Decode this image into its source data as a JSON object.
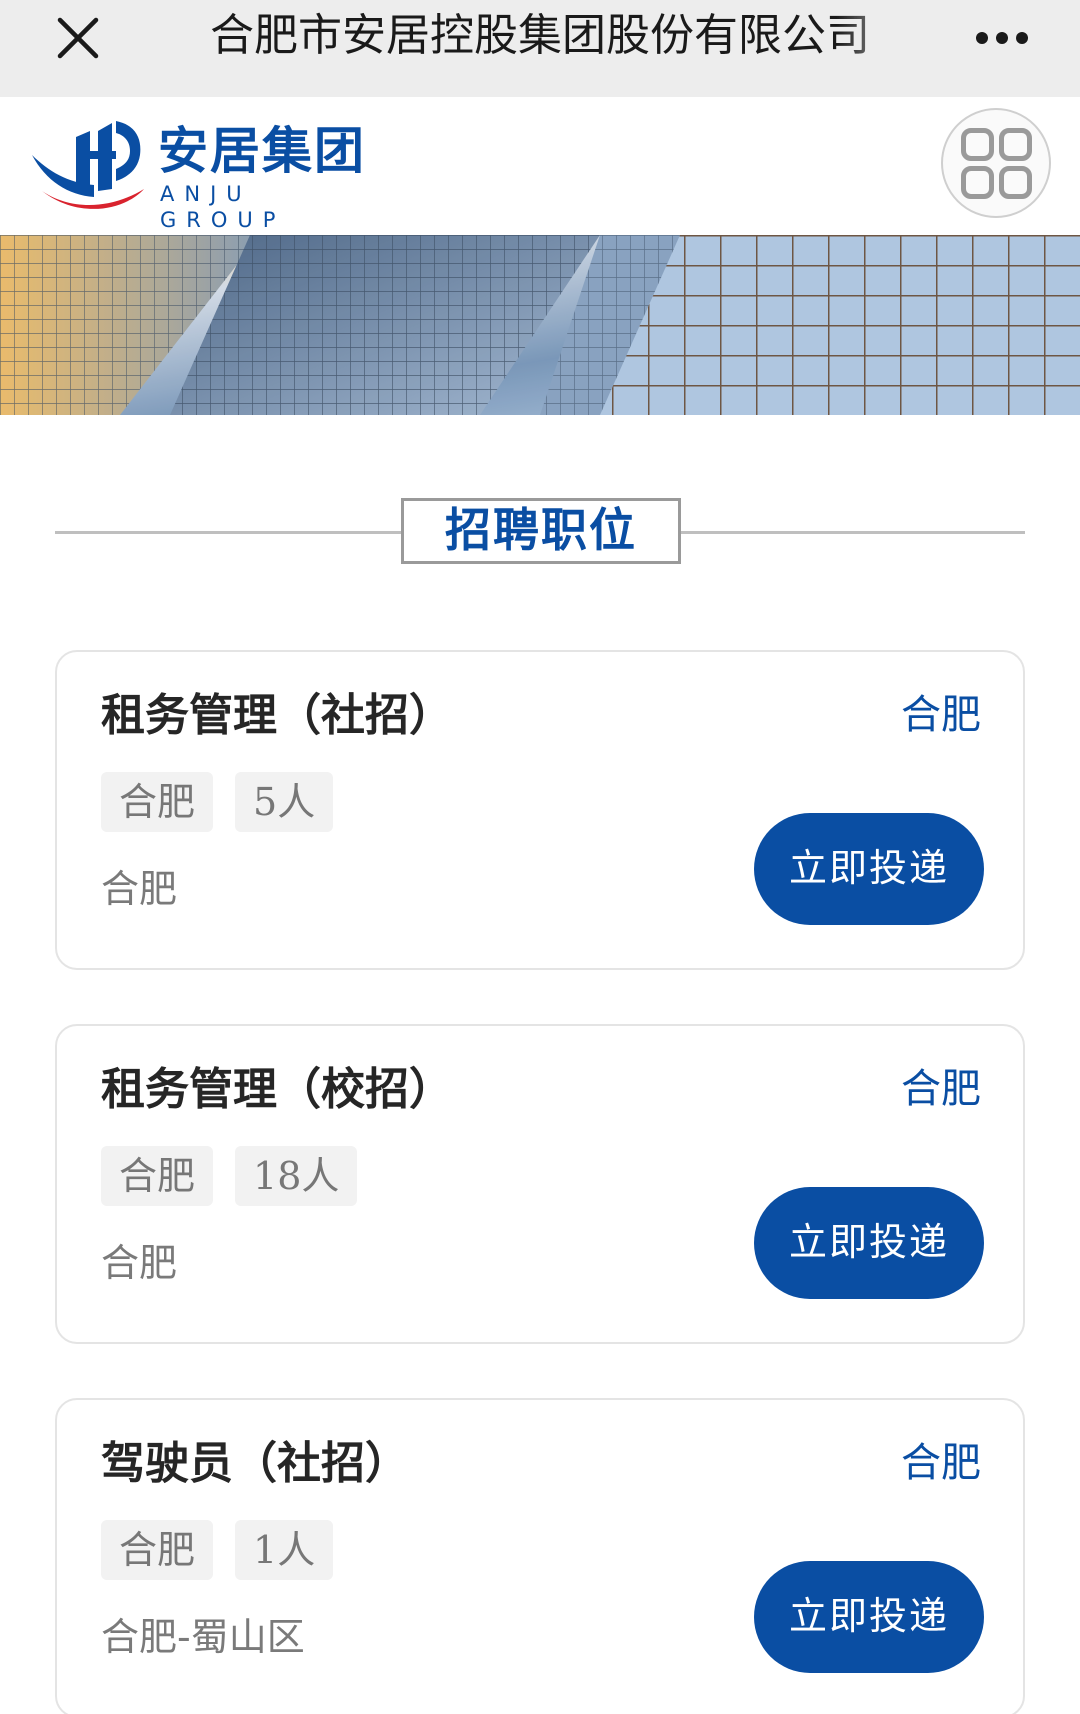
{
  "topbar": {
    "title": "合肥市安居控股集团股份有限公司",
    "close_icon": "close-icon",
    "more_icon": "more-dots-icon"
  },
  "header": {
    "logo_cn": "安居集团",
    "logo_en": "ANJU GROUP",
    "menu_icon": "grid-menu-icon"
  },
  "section": {
    "title": "招聘职位"
  },
  "colors": {
    "brand_blue": "#0a4ea3",
    "logo_red": "#d9232e",
    "tag_bg": "#f2f2f2"
  },
  "jobs": [
    {
      "title": "租务管理（社招）",
      "city": "合肥",
      "tags": [
        "合肥",
        "5人"
      ],
      "location": "合肥",
      "apply_label": "立即投递"
    },
    {
      "title": "租务管理（校招）",
      "city": "合肥",
      "tags": [
        "合肥",
        "18人"
      ],
      "location": "合肥",
      "apply_label": "立即投递"
    },
    {
      "title": "驾驶员（社招）",
      "city": "合肥",
      "tags": [
        "合肥",
        "1人"
      ],
      "location": "合肥-蜀山区",
      "apply_label": "立即投递"
    }
  ]
}
